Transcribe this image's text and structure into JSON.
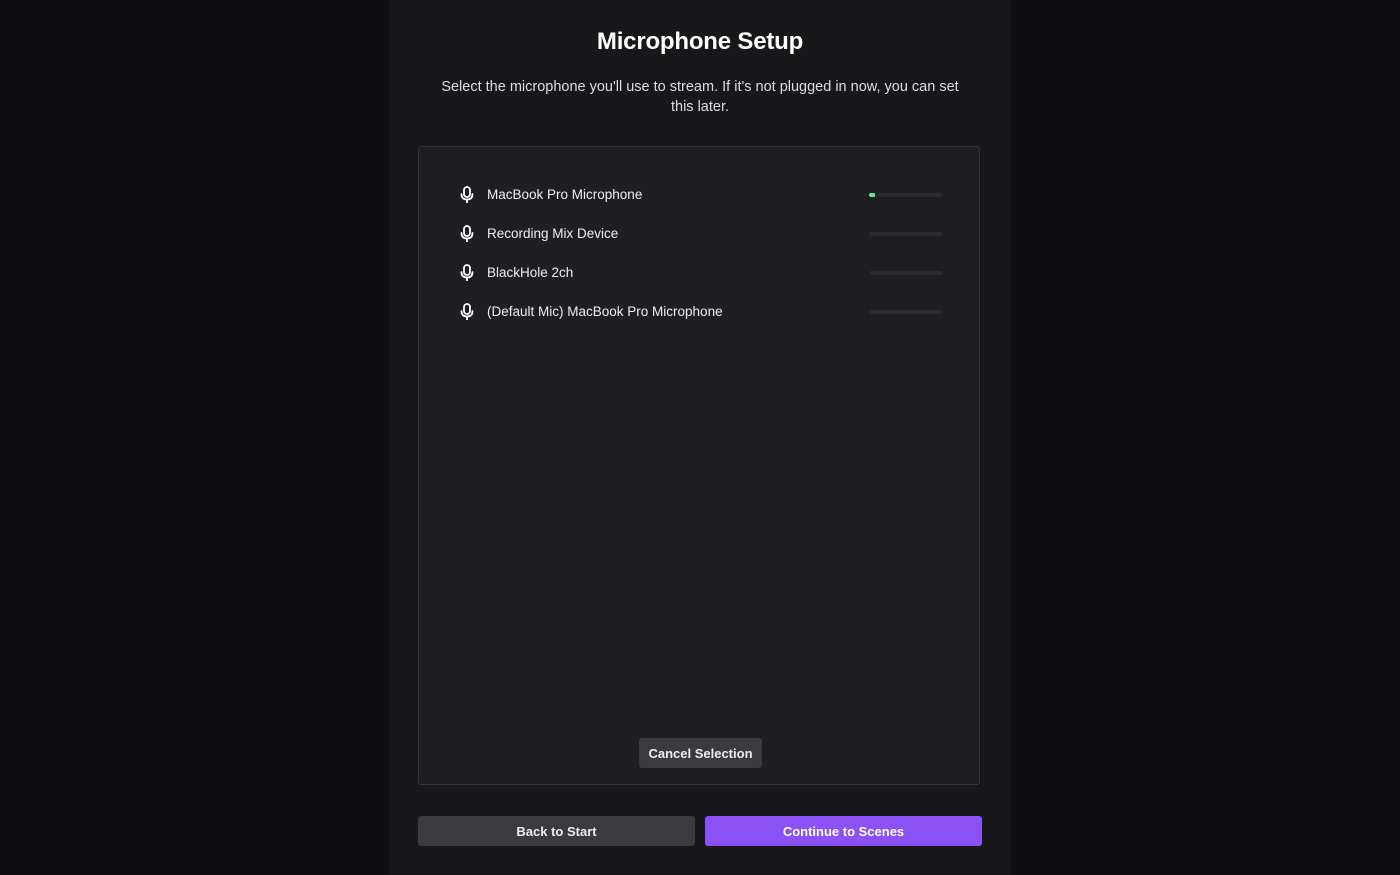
{
  "header": {
    "title": "Microphone Setup",
    "subtitle": "Select the microphone you'll use to stream. If it's not plugged in now, you can set this later."
  },
  "devices": [
    {
      "label": "MacBook Pro Microphone",
      "icon": "microphone-icon",
      "level_fraction": 0.08
    },
    {
      "label": "Recording Mix Device",
      "icon": "microphone-icon",
      "level_fraction": 0
    },
    {
      "label": "BlackHole 2ch",
      "icon": "microphone-icon",
      "level_fraction": 0
    },
    {
      "label": "(Default Mic) MacBook Pro Microphone",
      "icon": "microphone-icon",
      "level_fraction": 0
    }
  ],
  "device_box": {
    "cancel_label": "Cancel Selection"
  },
  "footer": {
    "back_label": "Back to Start",
    "continue_label": "Continue to Scenes"
  },
  "colors": {
    "accent": "#8b51f5",
    "level_meter": "#5cf08a",
    "panel_bg": "#18181b",
    "page_bg": "#0e0e10"
  }
}
